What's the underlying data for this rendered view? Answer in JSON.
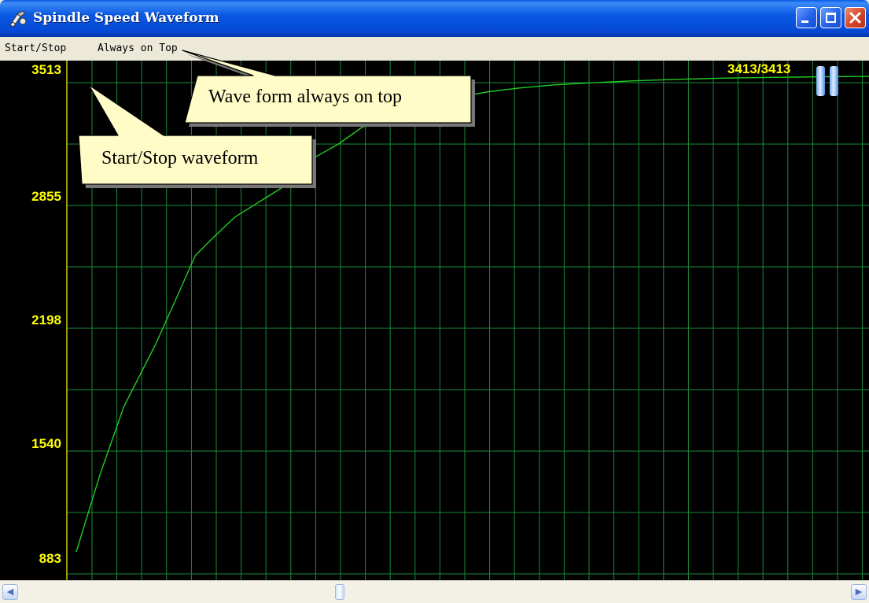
{
  "window": {
    "title": "Spindle Speed Waveform",
    "icon": "spindle-icon",
    "buttons": [
      "minimize-icon",
      "maximize-icon",
      "close-icon"
    ],
    "accent": "#0a5ae3"
  },
  "menu": {
    "items": [
      {
        "label": "Start/Stop"
      },
      {
        "label": "Always on Top"
      }
    ]
  },
  "display": {
    "counter": "3413/3413",
    "pause_icon": "pause-icon",
    "background_color": "#000000",
    "grid_color": "#1a8a3a",
    "line_color": "#22cc22",
    "label_color": "#ffff00"
  },
  "callouts": [
    {
      "text": "Wave form always on top",
      "points_to": "Always on Top"
    },
    {
      "text": "Start/Stop waveform",
      "points_to": "Start/Stop"
    }
  ],
  "chart_data": {
    "type": "line",
    "title": "",
    "xlabel": "",
    "ylabel": "",
    "y_ticks": [
      "3513",
      "2855",
      "2198",
      "1540",
      "883"
    ],
    "ylim": [
      883,
      3513
    ],
    "xlim": [
      0,
      100
    ],
    "grid": true,
    "series": [
      {
        "x": [
          0,
          3,
          6,
          10,
          13,
          15,
          17,
          20,
          24,
          28,
          30,
          33,
          36,
          39,
          41,
          43,
          48,
          52,
          56,
          60,
          64,
          70,
          76,
          82,
          88,
          94,
          100
        ],
        "values": [
          950,
          1360,
          1720,
          2050,
          2330,
          2520,
          2605,
          2725,
          2830,
          2935,
          3040,
          3110,
          3200,
          3250,
          3290,
          3315,
          3360,
          3390,
          3410,
          3425,
          3435,
          3447,
          3456,
          3462,
          3466,
          3469,
          3471
        ]
      }
    ]
  },
  "scrollbar": {
    "thumb_position": 0.39
  }
}
